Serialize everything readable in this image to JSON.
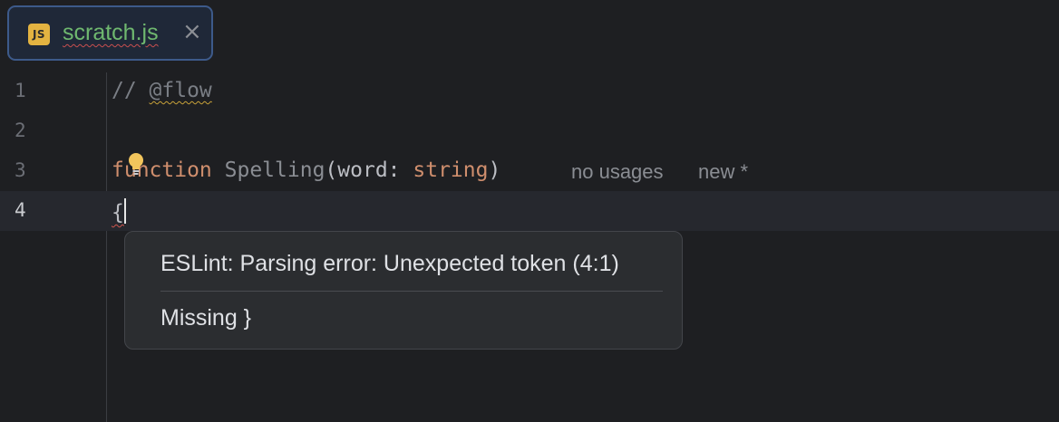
{
  "tab": {
    "icon_text": "JS",
    "file_name": "scratch.js",
    "close_glyph": "×"
  },
  "editor": {
    "lines": [
      {
        "number": "1",
        "comment": "// ",
        "flow": "@flow"
      },
      {
        "number": "2"
      },
      {
        "number": "3",
        "keyword": "function",
        "fn_name": "Spelling",
        "open_paren": "(",
        "param": "word",
        "colon": ": ",
        "type": "string",
        "close_paren": ")",
        "hint_usages": "no usages",
        "hint_new": "new *"
      },
      {
        "number": "4",
        "brace": "{"
      }
    ]
  },
  "popup": {
    "message": "ESLint: Parsing error: Unexpected token (4:1)",
    "action": "Missing }"
  },
  "colors": {
    "tab_border": "#3d5a8a",
    "bulb": "#f2c55c",
    "error_underline": "#d0564e"
  }
}
